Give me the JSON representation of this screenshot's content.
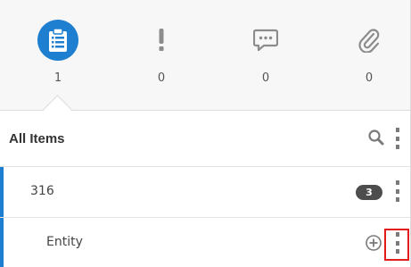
{
  "tabs": [
    {
      "name": "checklist",
      "icon": "clipboard-list-icon",
      "count": "1",
      "active": true
    },
    {
      "name": "alerts",
      "icon": "exclamation-icon",
      "count": "0",
      "active": false
    },
    {
      "name": "comments",
      "icon": "chat-bubble-icon",
      "count": "0",
      "active": false
    },
    {
      "name": "attachments",
      "icon": "paperclip-icon",
      "count": "0",
      "active": false
    }
  ],
  "list": {
    "header": {
      "title": "All Items"
    },
    "rows": [
      {
        "label": "316",
        "badge": "3"
      },
      {
        "label": "Entity"
      }
    ]
  },
  "colors": {
    "accent": "#1e7fd1",
    "badge": "#4d4d4d",
    "highlight": "#e21b1b"
  }
}
